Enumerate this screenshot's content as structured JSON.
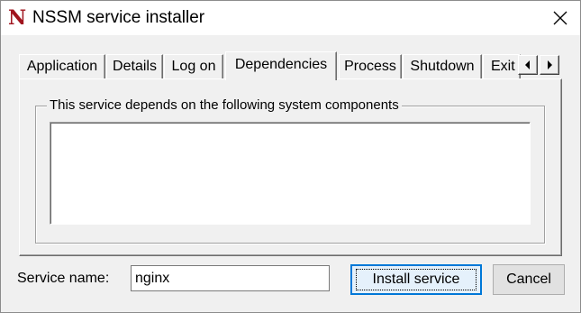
{
  "window": {
    "title": "NSSM service installer",
    "icon_letter": "N",
    "close_icon": "close-icon"
  },
  "tabs": [
    {
      "label": "Application"
    },
    {
      "label": "Details"
    },
    {
      "label": "Log on"
    },
    {
      "label": "Dependencies",
      "active": true
    },
    {
      "label": "Process"
    },
    {
      "label": "Shutdown"
    },
    {
      "label": "Exit"
    }
  ],
  "tab_scroll": {
    "left_icon": "arrow-left-icon",
    "right_icon": "arrow-right-icon"
  },
  "dependencies": {
    "group_label": "This service depends on the following system components",
    "list_value": ""
  },
  "footer": {
    "service_name_label": "Service name:",
    "service_name_value": "nginx",
    "install_label": "Install service",
    "cancel_label": "Cancel"
  },
  "colors": {
    "icon_red": "#a0141e",
    "focus_blue": "#0078d7"
  }
}
